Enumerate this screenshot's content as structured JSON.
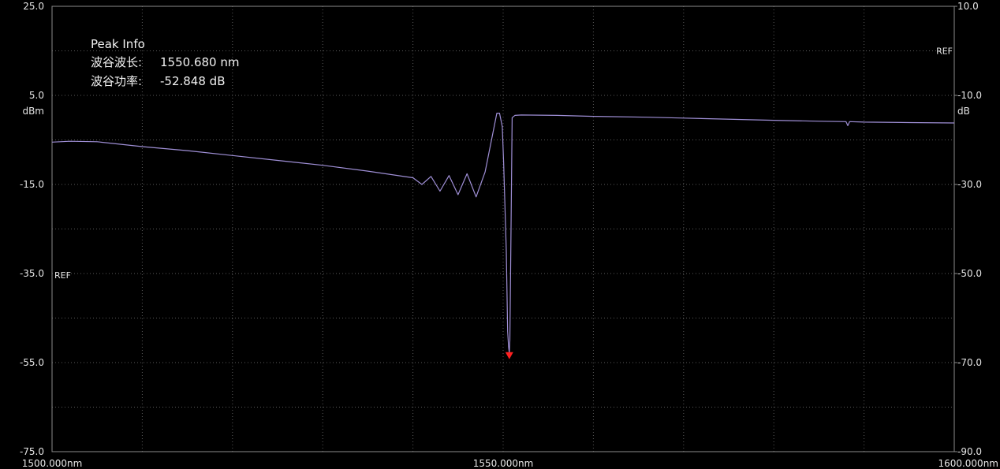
{
  "chart_data": {
    "type": "line",
    "x_unit_suffix": "nm",
    "xlim": [
      1500.0,
      1600.0
    ],
    "x_ticks": [
      "1500.000nm",
      "1550.000nm",
      "1600.000nm"
    ],
    "left_axis": {
      "unit": "dBm",
      "ylim": [
        -75.0,
        25.0
      ],
      "ticks": [
        "25.0",
        "5.0",
        "-15.0",
        "-35.0",
        "-55.0",
        "-75.0"
      ],
      "ref_label": "REF",
      "ref_value": -35.0
    },
    "right_axis": {
      "unit": "dB",
      "ylim": [
        -90.0,
        10.0
      ],
      "ticks": [
        "10.0",
        "-10.0",
        "-30.0",
        "-50.0",
        "-70.0",
        "-90.0"
      ],
      "ref_label": "REF",
      "ref_value": 0.0
    },
    "grid": true,
    "line_color": "#9f8fd6",
    "marker_color": "#ff2020",
    "peak_info": {
      "title": "Peak Info",
      "wavelength_label": "波谷波长:",
      "wavelength_value": "1550.680 nm",
      "power_label": "波谷功率:",
      "power_value": "-52.848 dB"
    },
    "series": [
      {
        "x": [
          1500.0,
          1502.0,
          1505.0,
          1510.0,
          1515.0,
          1520.0,
          1525.0,
          1530.0,
          1535.0,
          1540.0,
          1541.0,
          1542.0,
          1543.0,
          1544.0,
          1545.0,
          1546.0,
          1547.0,
          1548.0,
          1549.0,
          1549.3,
          1549.6,
          1549.9,
          1550.05,
          1550.35,
          1550.5,
          1550.6,
          1550.68,
          1550.74,
          1550.85,
          1551.0,
          1551.3,
          1552.0,
          1556.0,
          1560.0,
          1566.0,
          1570.0,
          1576.0,
          1580.0,
          1585.0,
          1588.0,
          1588.2,
          1588.4,
          1590.0,
          1595.0,
          1600.0
        ],
        "y": [
          -5.5,
          -5.3,
          -5.4,
          -6.5,
          -7.4,
          -8.5,
          -9.6,
          -10.7,
          -12.0,
          -13.5,
          -15.0,
          -13.2,
          -16.5,
          -13.0,
          -17.3,
          -12.6,
          -17.8,
          -12.2,
          -2.0,
          1.0,
          1.0,
          -2.0,
          -10.0,
          -30.0,
          -48.0,
          -51.5,
          -52.848,
          -50.0,
          -30.0,
          0.0,
          0.5,
          0.6,
          0.5,
          0.3,
          0.1,
          -0.1,
          -0.4,
          -0.6,
          -0.8,
          -0.9,
          -1.8,
          -0.9,
          -1.0,
          -1.1,
          -1.2
        ]
      }
    ]
  }
}
